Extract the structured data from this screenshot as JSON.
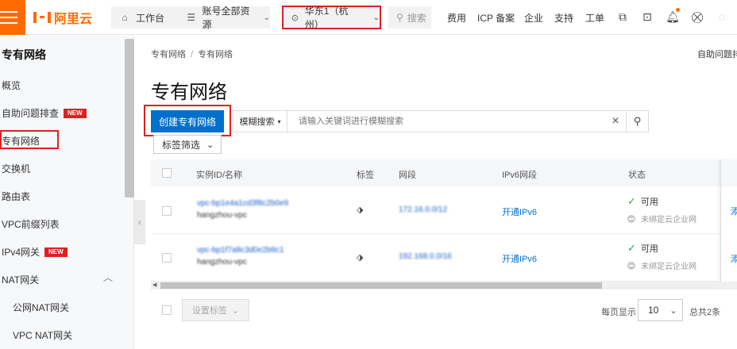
{
  "topbar": {
    "logo_text": "阿里云",
    "workbench": "工作台",
    "resources": "账号全部资源",
    "region": "华东1（杭州）",
    "search_placeholder": "搜索",
    "links": [
      "费用",
      "ICP 备案",
      "企业",
      "支持",
      "工单"
    ]
  },
  "sidebar": {
    "title": "专有网络",
    "items": [
      {
        "label": "概览"
      },
      {
        "label": "自助问题排查",
        "badge": "NEW"
      },
      {
        "label": "专有网络"
      },
      {
        "label": "交换机"
      },
      {
        "label": "路由表"
      },
      {
        "label": "VPC前缀列表"
      },
      {
        "label": "IPv4网关",
        "badge": "NEW"
      },
      {
        "label": "NAT网关"
      }
    ],
    "subitems": [
      "公网NAT网关",
      "VPC NAT网关"
    ]
  },
  "main": {
    "breadcrumb": [
      "专有网络",
      "专有网络"
    ],
    "topright_link": "自助问题排查",
    "page_title": "专有网络",
    "create_button": "创建专有网络",
    "search_type": "模糊搜索",
    "search_placeholder": "请输入关键词进行模糊搜索",
    "tag_filter": "标签筛选"
  },
  "table": {
    "columns": [
      "实例ID/名称",
      "标签",
      "网段",
      "IPv6网段",
      "状态"
    ],
    "rows": [
      {
        "id": "vpc-bp1e4a1cd3f8c2b0e9",
        "name": "hangzhou-vpc",
        "cidr": "172.16.0.0/12",
        "ipv6": "开通IPv6",
        "status": "可用",
        "ent": "未绑定云企业网",
        "action": "添"
      },
      {
        "id": "vpc-bp1f7a8c3d0e2b9c1",
        "name": "hangzhou-vpc",
        "cidr": "192.168.0.0/16",
        "ipv6": "开通IPv6",
        "status": "可用",
        "ent": "未绑定云企业网",
        "action": "添"
      }
    ]
  },
  "footer": {
    "set_tag": "设置标签",
    "per_page_label": "每页显示",
    "page_size": "10",
    "total": "总共2条"
  }
}
